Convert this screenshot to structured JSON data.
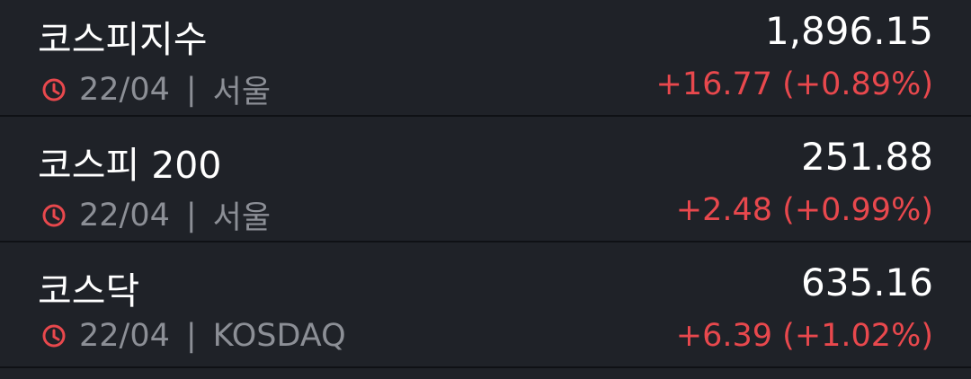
{
  "accent_colors": {
    "up": "#e8484d",
    "clock": "#e8484d",
    "muted": "#8c8f96"
  },
  "indices": [
    {
      "name": "코스피지수",
      "value": "1,896.15",
      "date": "22/04",
      "separator": "|",
      "market": "서울",
      "change": "+16.77 (+0.89%)",
      "icon": "clock-icon"
    },
    {
      "name": "코스피 200",
      "value": "251.88",
      "date": "22/04",
      "separator": "|",
      "market": "서울",
      "change": "+2.48 (+0.99%)",
      "icon": "clock-icon"
    },
    {
      "name": "코스닥",
      "value": "635.16",
      "date": "22/04",
      "separator": "|",
      "market": "KOSDAQ",
      "change": "+6.39 (+1.02%)",
      "icon": "clock-icon"
    }
  ]
}
